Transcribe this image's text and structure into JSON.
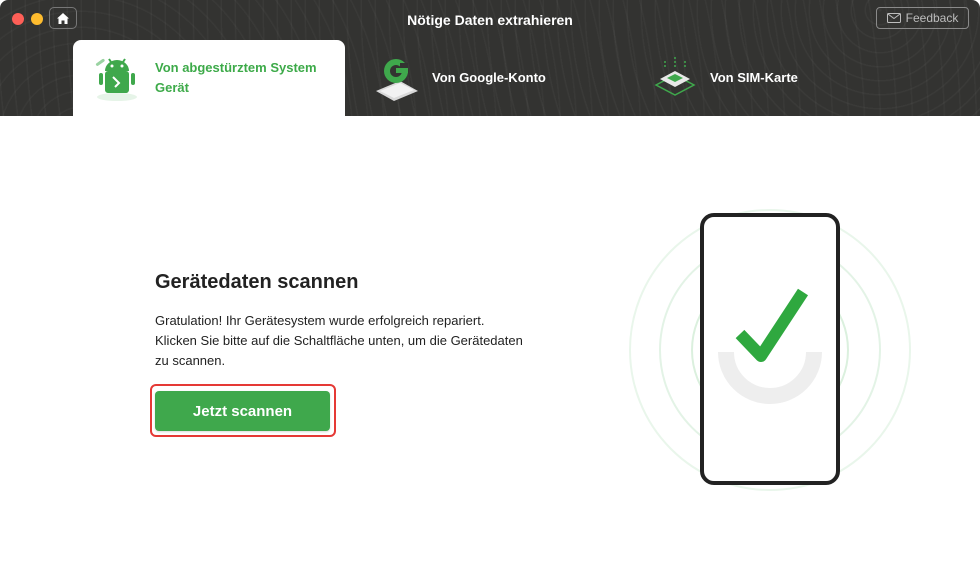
{
  "window": {
    "title": "Nötige Daten extrahieren",
    "feedback_label": "Feedback"
  },
  "tabs": [
    {
      "label_line1": "Von abgestürztem System",
      "label_line2": "Gerät",
      "active": true,
      "icon": "android-repair-icon"
    },
    {
      "label": "Von Google-Konto",
      "active": false,
      "icon": "google-account-icon"
    },
    {
      "label": "Von SIM-Karte",
      "active": false,
      "icon": "sim-card-icon"
    }
  ],
  "main": {
    "heading": "Gerätedaten scannen",
    "description_lines": [
      "Gratulation! Ihr Gerätesystem wurde erfolgreich repariert.",
      "Klicken Sie bitte auf die Schaltfläche unten, um die Gerätedaten",
      "zu scannen."
    ],
    "scan_button": "Jetzt scannen"
  },
  "illustration": {
    "icon": "phone-checkmark-icon"
  },
  "colors": {
    "accent": "#3fa84c",
    "header_bg": "#333331",
    "highlight": "#e53935"
  }
}
